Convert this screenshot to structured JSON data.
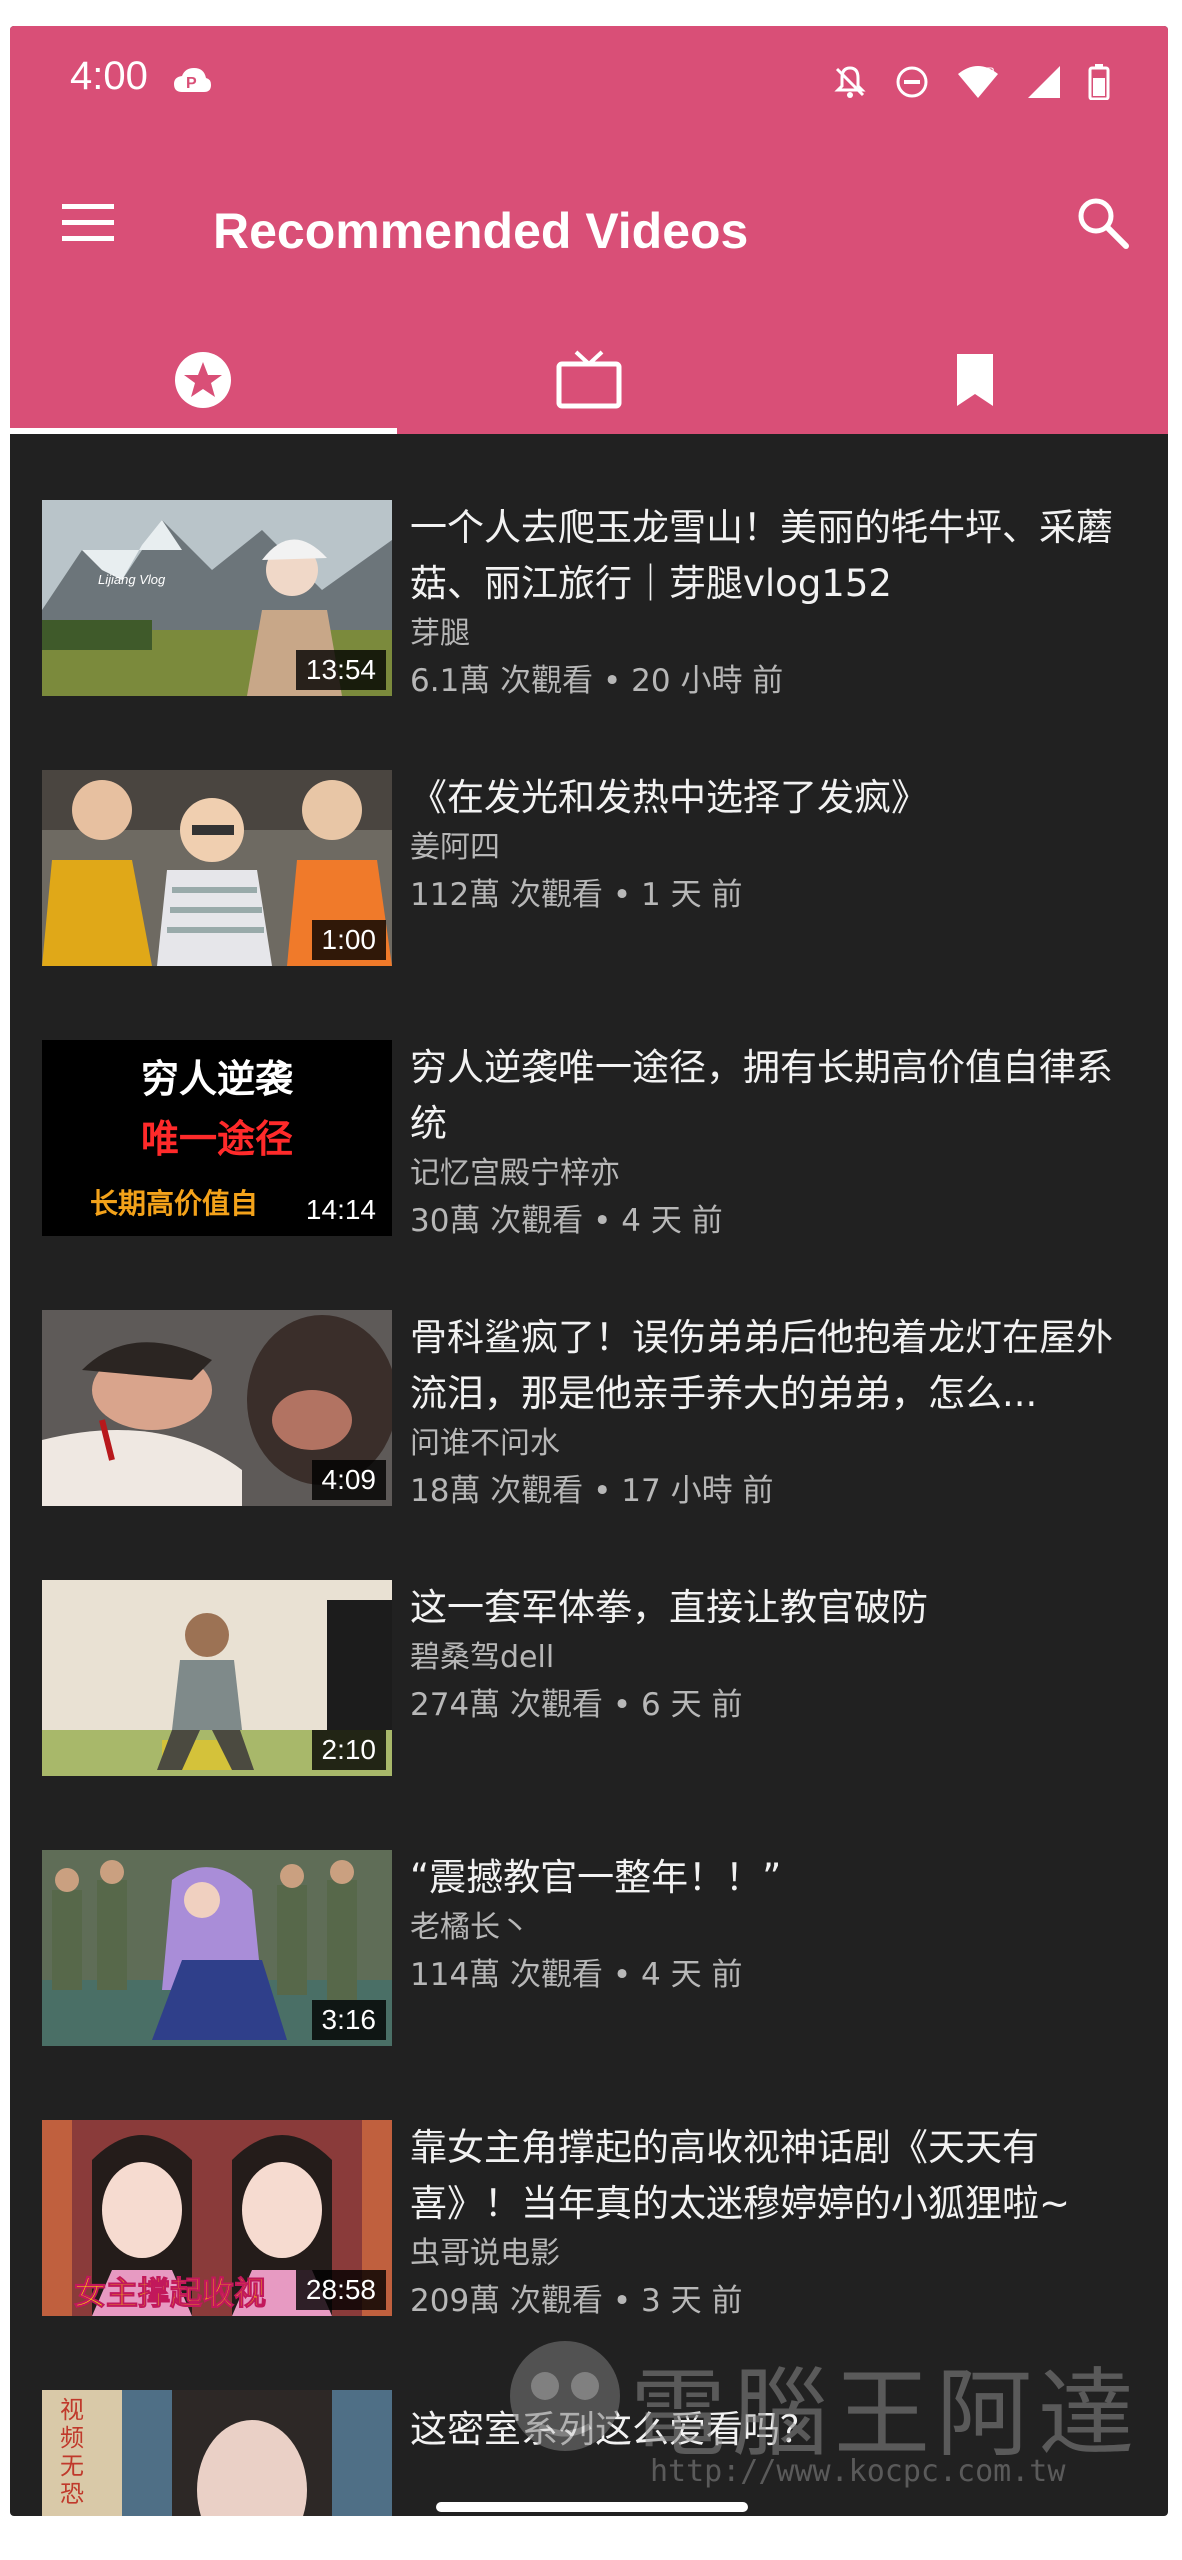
{
  "status_bar": {
    "time": "4:00"
  },
  "app_bar": {
    "title": "Recommended Videos"
  },
  "tabs": [
    {
      "name": "favorites",
      "icon": "star-icon",
      "selected": true
    },
    {
      "name": "tv",
      "icon": "tv-icon",
      "selected": false
    },
    {
      "name": "bookmarks",
      "icon": "bookmark-icon",
      "selected": false
    }
  ],
  "videos": [
    {
      "title": "一个人去爬玉龙雪山！美丽的牦牛坪、采蘑菇、丽江旅行｜芽腿vlog152",
      "channel": "芽腿",
      "stats": "6.1萬 次觀看 • 20 小時 前",
      "duration": "13:54",
      "thumb_text": [
        "Lijiang Vlog"
      ]
    },
    {
      "title": "《在发光和发热中选择了发疯》",
      "channel": "姜阿四",
      "stats": "112萬 次觀看 • 1 天 前",
      "duration": "1:00",
      "thumb_text": []
    },
    {
      "title": "穷人逆袭唯一途径，拥有长期高价值自律系统",
      "channel": "记忆宫殿宁梓亦",
      "stats": "30萬 次觀看 • 4 天 前",
      "duration": "14:14",
      "thumb_text": [
        "穷人逆袭",
        "唯一途径",
        "长期高价值自"
      ]
    },
    {
      "title": "骨科鲨疯了！误伤弟弟后他抱着龙灯在屋外流泪，那是他亲手养大的弟弟，怎么...",
      "channel": "问谁不问水",
      "stats": "18萬 次觀看 • 17 小時 前",
      "duration": "4:09",
      "thumb_text": []
    },
    {
      "title": "这一套军体拳，直接让教官破防",
      "channel": "碧桑驾dell",
      "stats": "274萬 次觀看 • 6 天 前",
      "duration": "2:10",
      "thumb_text": []
    },
    {
      "title": "“震撼教官一整年！！”",
      "channel": "老橘长丶",
      "stats": "114萬 次觀看 • 4 天 前",
      "duration": "3:16",
      "thumb_text": []
    },
    {
      "title": "靠女主角撑起的高收视神话剧《天天有喜》！当年真的太迷穆婷婷的小狐狸啦~",
      "channel": "虫哥说电影",
      "stats": "209萬 次觀看 • 3 天 前",
      "duration": "28:58",
      "thumb_text": [
        "女主撑起收视"
      ]
    },
    {
      "title": "这密室系列这么爱看吗？",
      "channel": "",
      "stats": "",
      "duration": "",
      "thumb_text": [
        "视频无恐"
      ]
    }
  ],
  "watermark": {
    "text": "電腦王阿達",
    "url": "http://www.kocpc.com.tw"
  },
  "colors": {
    "app_bar": "#d94f77",
    "background": "#212121",
    "text_primary": "#f2f2f2",
    "text_secondary": "#b7b7b7"
  }
}
